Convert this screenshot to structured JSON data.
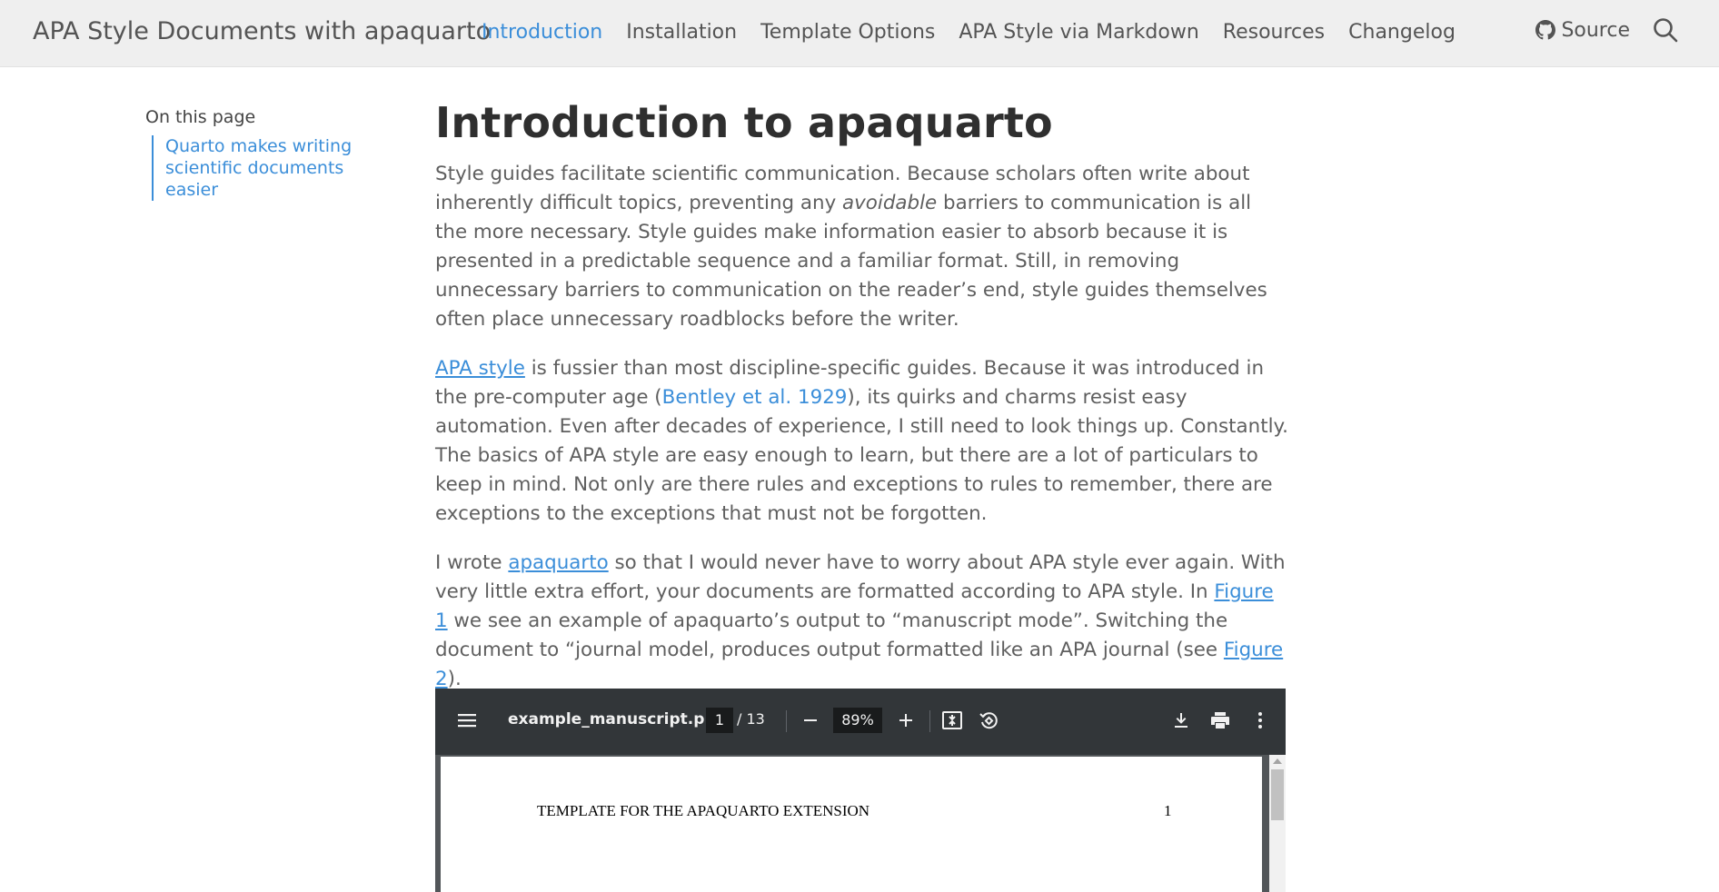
{
  "navbar": {
    "brand": "APA Style Documents with apaquarto",
    "links": [
      {
        "label": "Introduction",
        "active": true
      },
      {
        "label": "Installation"
      },
      {
        "label": "Template Options"
      },
      {
        "label": "APA Style via Markdown"
      },
      {
        "label": "Resources"
      },
      {
        "label": "Changelog"
      }
    ],
    "source_label": "Source",
    "source_icon": "github-icon",
    "search_icon": "search-icon"
  },
  "toc": {
    "title": "On this page",
    "items": [
      {
        "label": "Quarto makes writing scientific documents easier"
      }
    ]
  },
  "main": {
    "title": "Introduction to apaquarto",
    "p1": {
      "before": "Style guides facilitate scientific communication. Because scholars often write about inherently difficult topics, preventing any ",
      "emphasis": "avoidable",
      "after": " barriers to communication is all the more necessary. Style guides make information easier to absorb because it is presented in a predictable sequence and a familiar format. Still, in removing unnecessary barriers to communication on the reader’s end, style guides themselves often place unnecessary roadblocks before the writer."
    },
    "p2": {
      "link1": "APA style",
      "text1": " is fussier than most discipline-specific guides. Because it was introduced in the pre-computer age (",
      "citation": "Bentley et al. 1929",
      "text2": "), its quirks and charms resist easy automation. Even after decades of experience, I still need to look things up. Constantly. The basics of APA style are easy enough to learn, but there are a lot of particulars to keep in mind. Not only are there rules and exceptions to rules to remember, there are exceptions to the exceptions that must not be forgotten."
    },
    "p3": {
      "text1": "I wrote ",
      "link1": "apaquarto",
      "text2": " so that I would never have to worry about APA style ever again. With very little extra effort, your documents are formatted according to APA style. In ",
      "link2": "Figure 1",
      "text3": " we see an example of apaquarto’s output to “manuscript mode”. Switching the document to “journal model, produces output formatted like an APA journal (see ",
      "link3": "Figure 2",
      "text4": ")."
    }
  },
  "pdf": {
    "filename": "example_manuscript.p...",
    "current_page": "1",
    "total_pages": "/ 13",
    "zoom": "89%",
    "running_head": "TEMPLATE FOR THE APAQUARTO EXTENSION",
    "page_number": "1",
    "toolbar_bg": "#323639",
    "icons": [
      "menu-icon",
      "zoom-out-icon",
      "zoom-in-icon",
      "fit-page-icon",
      "rotate-icon",
      "download-icon",
      "print-icon",
      "more-icon"
    ]
  },
  "colors": {
    "accent": "#3b8ed9",
    "navbar_bg": "#efefef",
    "body_text": "#5f5f5f"
  }
}
